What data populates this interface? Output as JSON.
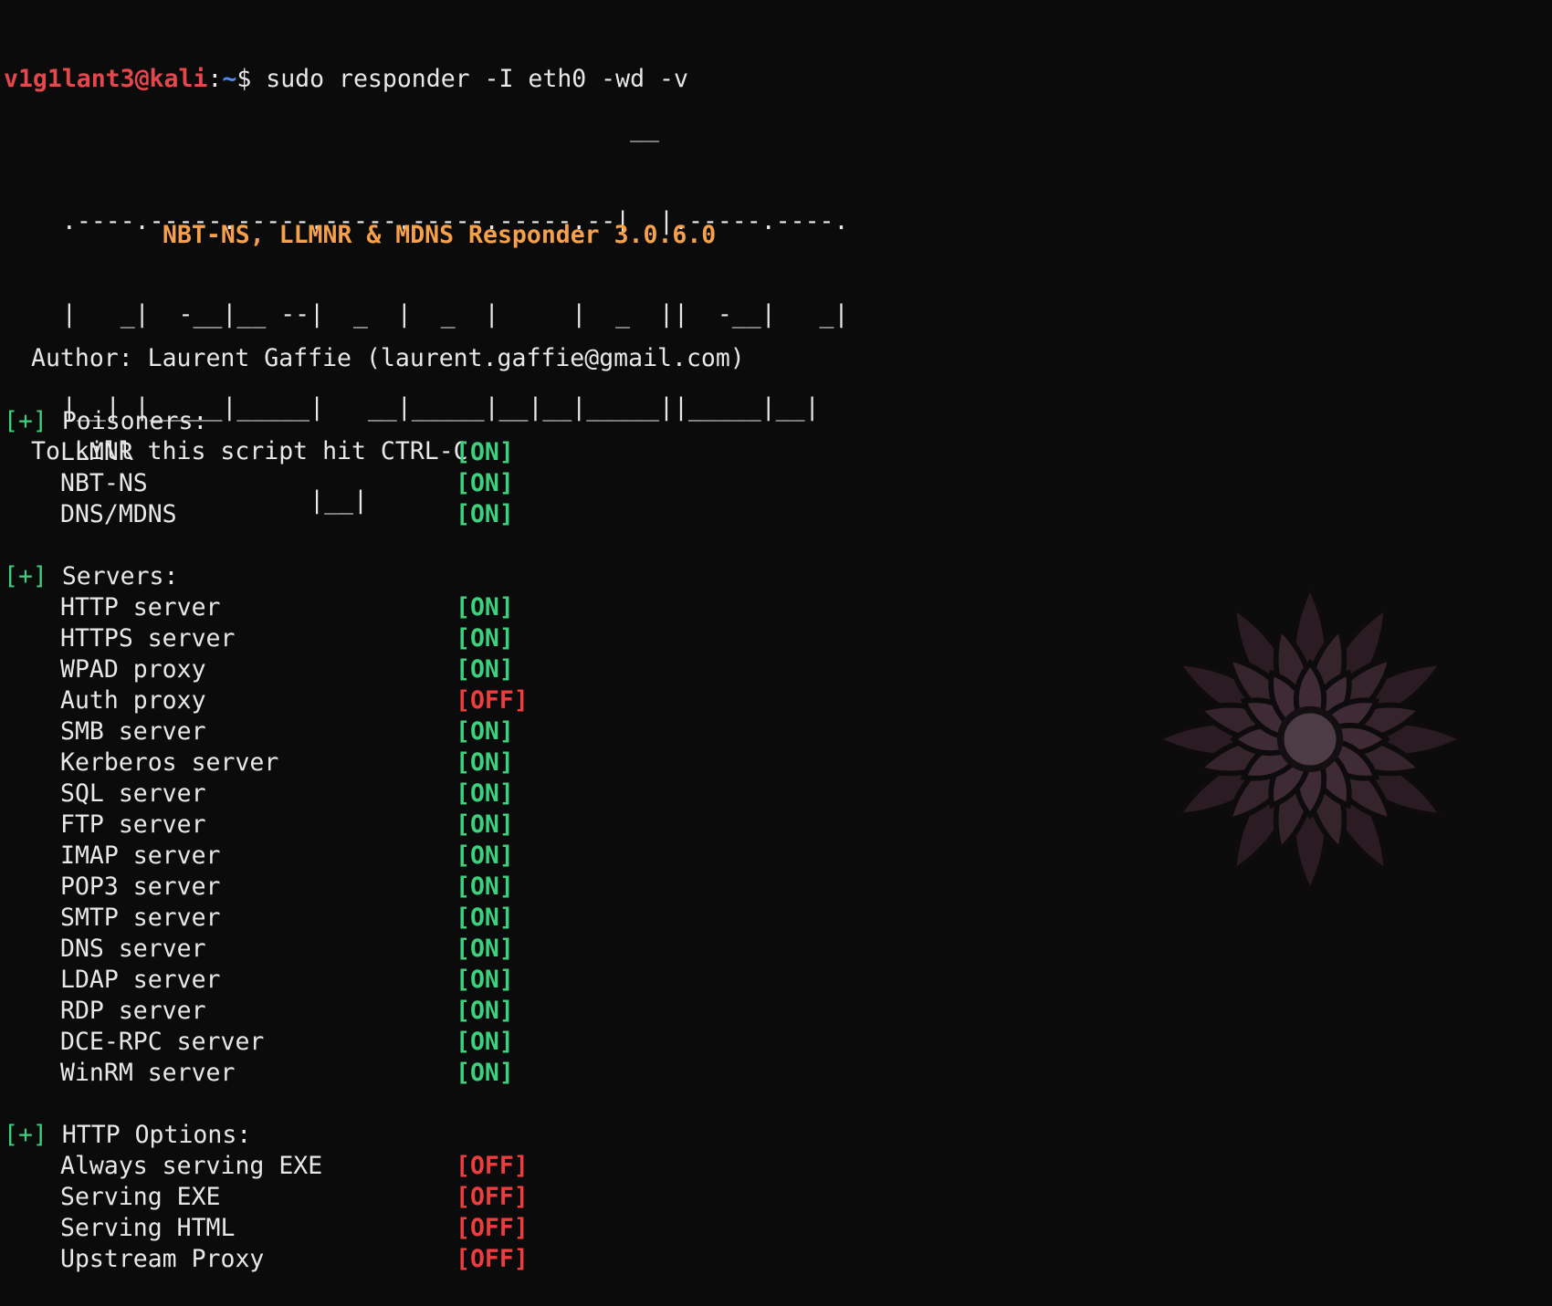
{
  "prompt": {
    "user_host": "v1g1lant3@kali",
    "colon": ":",
    "path": "~",
    "dollar": "$",
    "command": " sudo responder -I eth0 -wd -v"
  },
  "banner": {
    "lines": [
      "                                         __",
      "  .----.-----.-----.-----.-----.-----.--|  |.-----.----.",
      "  |   _|  -__|__ --|  _  |  _  |     |  _  ||  -__|   _|",
      "  |__| |_____|_____|   __|_____|__|__|_____||_____|__|",
      "                   |__|"
    ]
  },
  "subtitle": "NBT-NS, LLMNR & MDNS Responder 3.0.6.0",
  "info": {
    "author": "Author: Laurent Gaffie (laurent.gaffie@gmail.com)",
    "kill": "To kill this script hit CTRL-C"
  },
  "colors": {
    "on": "#3dd17e",
    "off": "#ef3d3d",
    "subtitle": "#f5a04a",
    "prompt_user": "#e5474d",
    "prompt_path": "#4d8cf0"
  },
  "sections": [
    {
      "marker": "[+]",
      "title": " Poisoners:",
      "rows": [
        {
          "label": "LLMNR",
          "status": "[ON]"
        },
        {
          "label": "NBT-NS",
          "status": "[ON]"
        },
        {
          "label": "DNS/MDNS",
          "status": "[ON]"
        }
      ]
    },
    {
      "marker": "[+]",
      "title": " Servers:",
      "rows": [
        {
          "label": "HTTP server",
          "status": "[ON]"
        },
        {
          "label": "HTTPS server",
          "status": "[ON]"
        },
        {
          "label": "WPAD proxy",
          "status": "[ON]"
        },
        {
          "label": "Auth proxy",
          "status": "[OFF]"
        },
        {
          "label": "SMB server",
          "status": "[ON]"
        },
        {
          "label": "Kerberos server",
          "status": "[ON]"
        },
        {
          "label": "SQL server",
          "status": "[ON]"
        },
        {
          "label": "FTP server",
          "status": "[ON]"
        },
        {
          "label": "IMAP server",
          "status": "[ON]"
        },
        {
          "label": "POP3 server",
          "status": "[ON]"
        },
        {
          "label": "SMTP server",
          "status": "[ON]"
        },
        {
          "label": "DNS server",
          "status": "[ON]"
        },
        {
          "label": "LDAP server",
          "status": "[ON]"
        },
        {
          "label": "RDP server",
          "status": "[ON]"
        },
        {
          "label": "DCE-RPC server",
          "status": "[ON]"
        },
        {
          "label": "WinRM server",
          "status": "[ON]"
        }
      ]
    },
    {
      "marker": "[+]",
      "title": " HTTP Options:",
      "rows": [
        {
          "label": "Always serving EXE",
          "status": "[OFF]"
        },
        {
          "label": "Serving EXE",
          "status": "[OFF]"
        },
        {
          "label": "Serving HTML",
          "status": "[OFF]"
        },
        {
          "label": "Upstream Proxy",
          "status": "[OFF]"
        }
      ]
    }
  ],
  "background_icon": "kali-dragon-watermark-icon"
}
